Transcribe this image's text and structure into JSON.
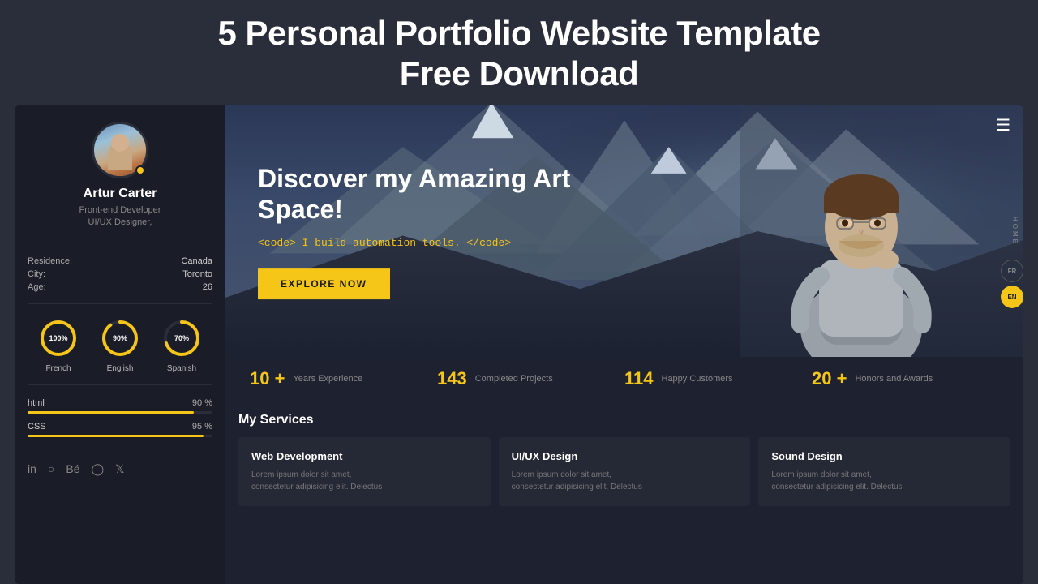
{
  "page": {
    "title": "5 Personal Portfolio Website Template\nFree Download"
  },
  "sidebar": {
    "profile": {
      "name": "Artur Carter",
      "title": "Front-end Developer\nUI/UX Designer,"
    },
    "info": {
      "residence_label": "Residence:",
      "residence_value": "Canada",
      "city_label": "City:",
      "city_value": "Toronto",
      "age_label": "Age:",
      "age_value": "26"
    },
    "languages": [
      {
        "label": "French",
        "percent": 100,
        "stroke_dasharray": "113",
        "stroke_dashoffset": "0"
      },
      {
        "label": "English",
        "percent": 90,
        "stroke_dasharray": "113",
        "stroke_dashoffset": "11"
      },
      {
        "label": "Spanish",
        "percent": 70,
        "stroke_dasharray": "113",
        "stroke_dashoffset": "34"
      }
    ],
    "skills": [
      {
        "name": "html",
        "percent": 90,
        "width": "90%"
      },
      {
        "name": "CSS",
        "percent": 95,
        "width": "95%"
      }
    ],
    "social_icons": [
      "linkedin",
      "globe",
      "behance",
      "github",
      "twitter"
    ]
  },
  "hero": {
    "nav_label": "HOME",
    "title": "Discover my Amazing Art Space!",
    "subtitle_code_open": "<code>",
    "subtitle_text": " I build automation tools. ",
    "subtitle_code_close": "</code>",
    "cta_label": "EXPLORE NOW",
    "lang_fr": "FR",
    "lang_en": "EN"
  },
  "stats": [
    {
      "number": "10 +",
      "label": "Years Experience"
    },
    {
      "number": "143",
      "label": "Completed Projects"
    },
    {
      "number": "114",
      "label": "Happy Customers"
    },
    {
      "number": "20 +",
      "label": "Honors and Awards"
    }
  ],
  "services": {
    "section_title": "My Services",
    "cards": [
      {
        "title": "Web Development",
        "desc": "Lorem ipsum dolor sit amet, consectetur adipisicing elit. Delectus"
      },
      {
        "title": "UI/UX Design",
        "desc": "Lorem ipsum dolor sit amet, consectetur adipisicing elit. Delectus"
      },
      {
        "title": "Sound Design",
        "desc": "Lorem ipsum dolor sit amet, consectetur adipisicing elit. Delectus"
      }
    ]
  }
}
